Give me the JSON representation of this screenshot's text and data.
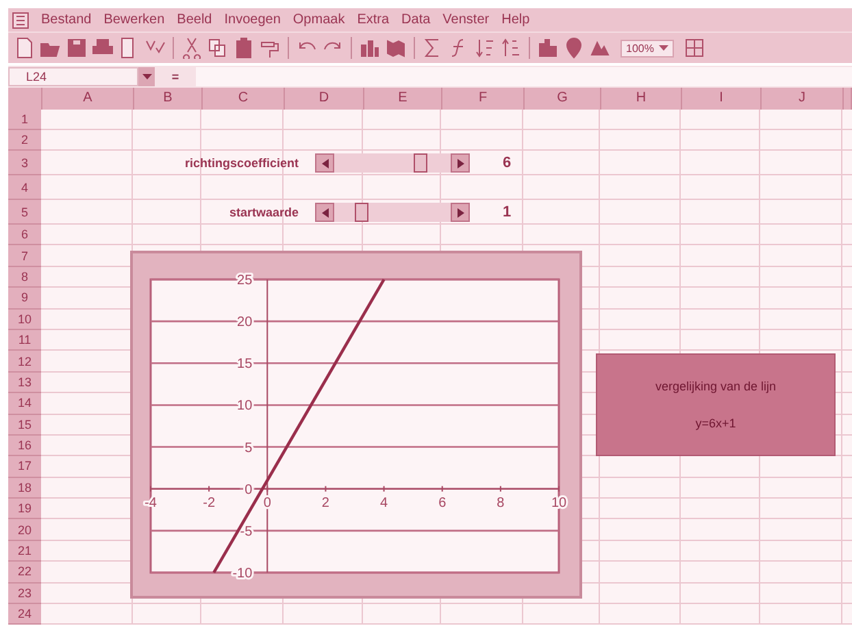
{
  "menu": [
    "Bestand",
    "Bewerken",
    "Beeld",
    "Invoegen",
    "Opmaak",
    "Extra",
    "Data",
    "Venster",
    "Help"
  ],
  "toolbar": {
    "zoom": "100%"
  },
  "formula_bar": {
    "name_box": "L24",
    "equals": "="
  },
  "columns": [
    "A",
    "B",
    "C",
    "D",
    "E",
    "F",
    "G",
    "H",
    "I",
    "J"
  ],
  "rows": [
    "1",
    "2",
    "3",
    "4",
    "5",
    "6",
    "7",
    "8",
    "9",
    "10",
    "11",
    "12",
    "13",
    "14",
    "15",
    "16",
    "17",
    "18",
    "19",
    "20",
    "21",
    "22",
    "23",
    "24"
  ],
  "controls": [
    {
      "label": "richtingscoefficient",
      "value": "6"
    },
    {
      "label": "startwaarde",
      "value": "1"
    }
  ],
  "chart": {
    "chart_data": {
      "type": "line",
      "grid": true,
      "x": [
        -1.8333,
        4
      ],
      "series": [
        {
          "color": "#9a2e4c",
          "values": [
            -10,
            25
          ]
        }
      ],
      "xlim": [
        -4,
        10
      ],
      "ylim": [
        -10,
        25
      ],
      "xticks": [
        -4,
        -2,
        0,
        2,
        4,
        6,
        8,
        10
      ],
      "yticks": [
        -10,
        -5,
        0,
        5,
        10,
        15,
        20,
        25
      ]
    }
  },
  "text_box": {
    "lines": [
      "vergelijking van de lijn",
      "y=6x+1"
    ]
  }
}
